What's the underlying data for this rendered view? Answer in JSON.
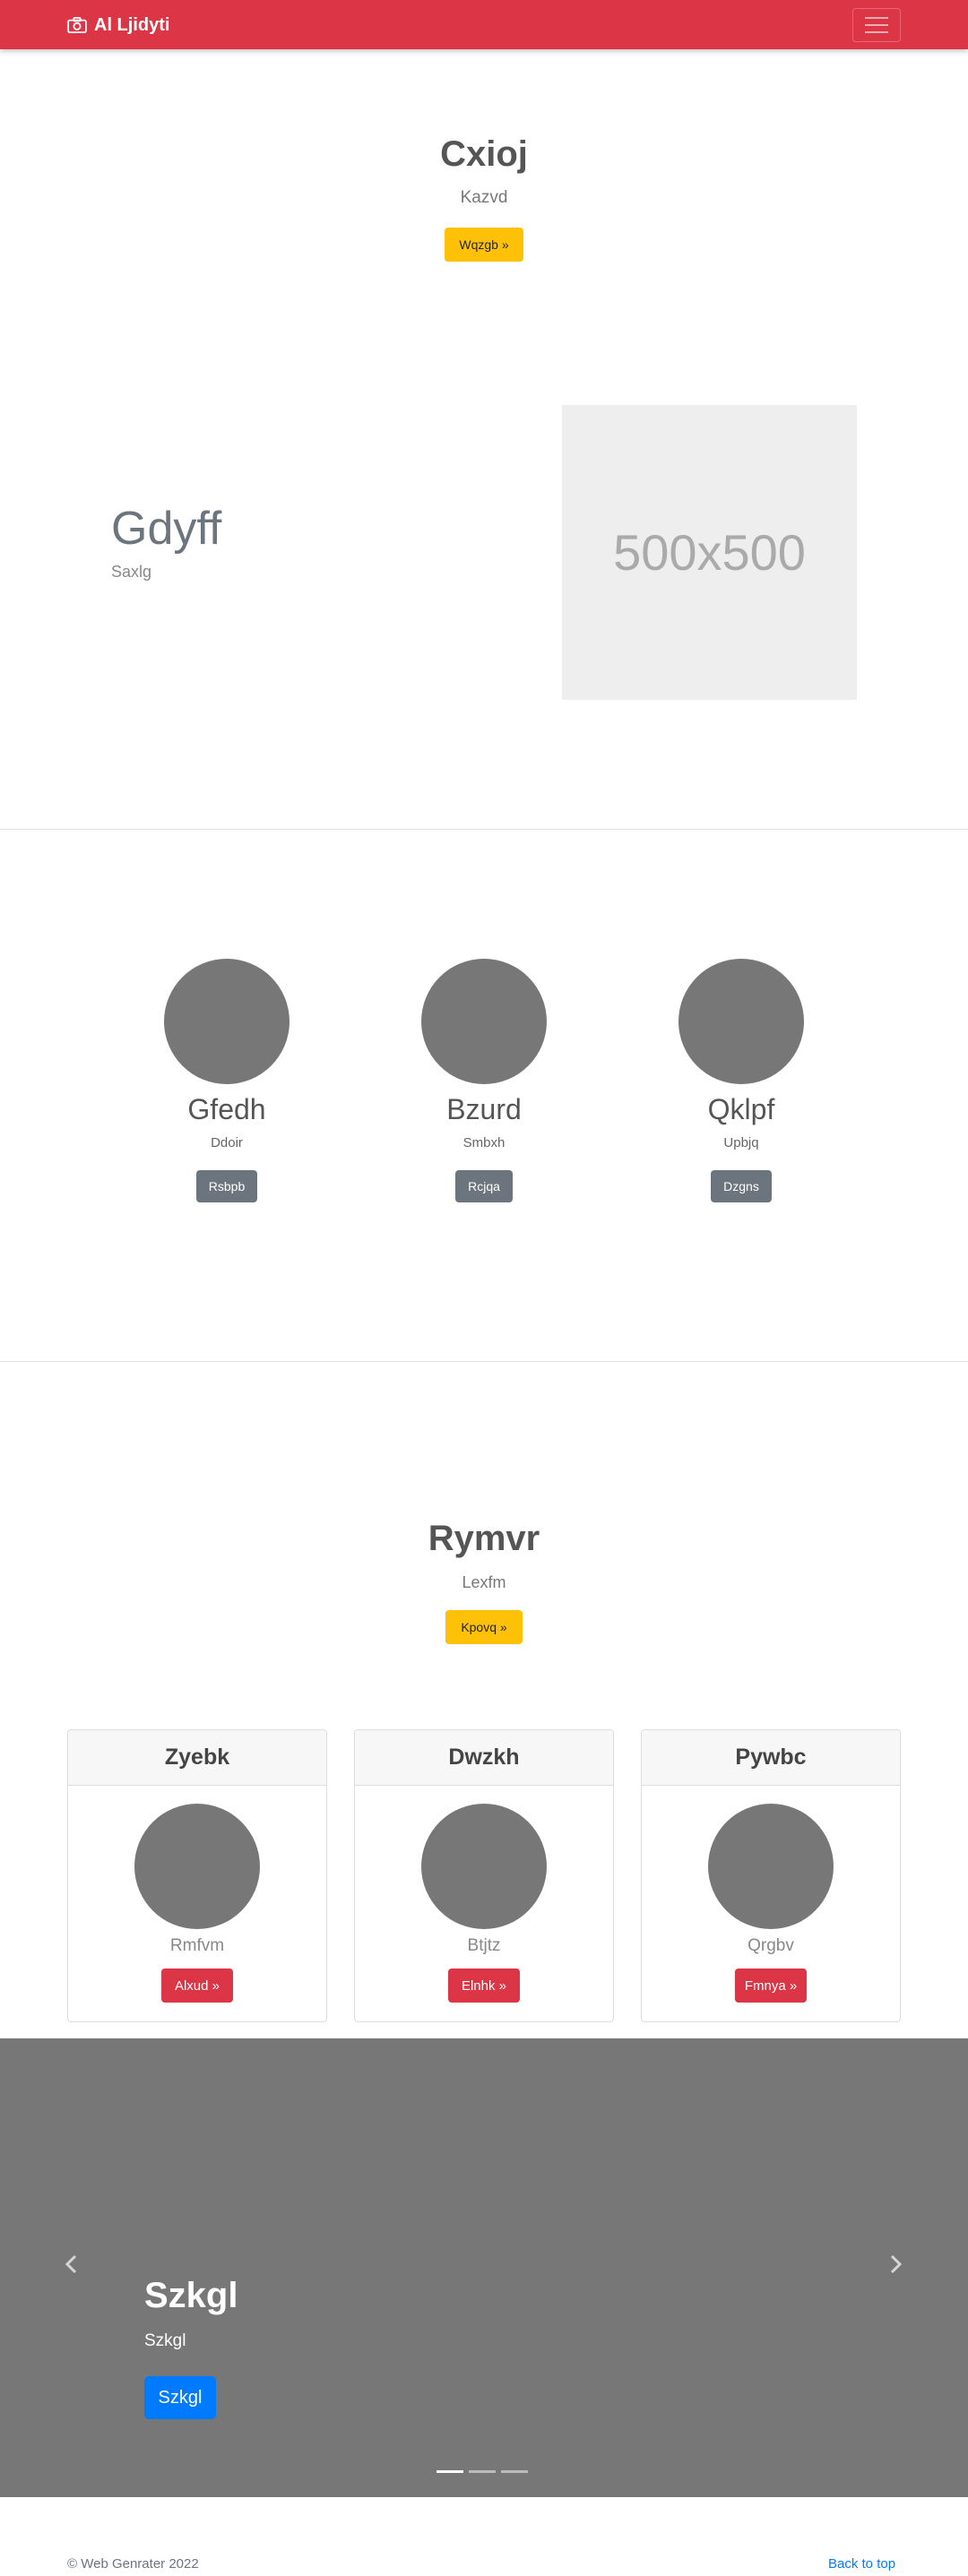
{
  "navbar": {
    "brand_icon": "camera-icon",
    "brand": "Al Ljidyti",
    "toggle_icon": "hamburger-icon",
    "color": "#dc3545"
  },
  "hero": {
    "title": "Cxioj",
    "subtitle": "Kazvd",
    "button": "Wqzgb »"
  },
  "feature": {
    "title": "Gdyff",
    "subtitle": "Saxlg",
    "image_text": "500x500"
  },
  "team": [
    {
      "name": "Gfedh",
      "role": "Ddoir",
      "button": "Rsbpb"
    },
    {
      "name": "Bzurd",
      "role": "Smbxh",
      "button": "Rcjqa"
    },
    {
      "name": "Qklpf",
      "role": "Upbjq",
      "button": "Dzgns"
    }
  ],
  "section2": {
    "title": "Rymvr",
    "subtitle": "Lexfm",
    "button": "Kpovq »"
  },
  "cards": [
    {
      "header": "Zyebk",
      "text": "Rmfvm",
      "button": "Alxud »"
    },
    {
      "header": "Dwzkh",
      "text": "Btjtz",
      "button": "Elnhk »"
    },
    {
      "header": "Pywbc",
      "text": "Qrgbv",
      "button": "Fmnya »"
    }
  ],
  "carousel": {
    "title": "Szkgl",
    "subtitle": "Szkgl",
    "button": "Szkgl",
    "slides": 3,
    "active_slide": 1,
    "prev_icon": "chevron-left-icon",
    "next_icon": "chevron-right-icon"
  },
  "footer": {
    "copyright": "© Web Genrater 2022",
    "back_to_top": "Back to top"
  }
}
